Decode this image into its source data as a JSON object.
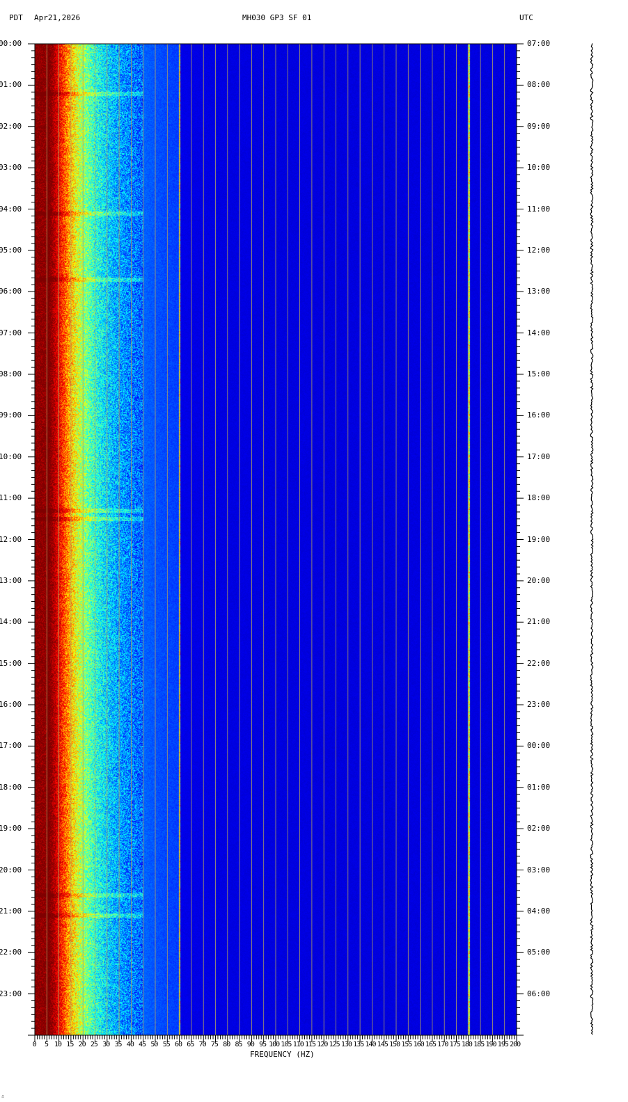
{
  "header": {
    "left_tz": "PDT",
    "date": "Apr21,2026",
    "station": "MH030 GP3 SF 01",
    "right_tz": "UTC"
  },
  "footer_mark": "∴",
  "chart_data": {
    "type": "heatmap",
    "title": "MH030 GP3 SF 01",
    "xlabel": "FREQUENCY (HZ)",
    "xlim": [
      0,
      200
    ],
    "x_ticks": [
      0,
      5,
      10,
      15,
      20,
      25,
      30,
      35,
      40,
      45,
      50,
      55,
      60,
      65,
      70,
      75,
      80,
      85,
      90,
      95,
      100,
      105,
      110,
      115,
      120,
      125,
      130,
      135,
      140,
      145,
      150,
      155,
      160,
      165,
      170,
      175,
      180,
      185,
      190,
      195,
      200
    ],
    "ylim_hours": [
      0,
      24
    ],
    "y_left_labels": [
      "00:00",
      "01:00",
      "02:00",
      "03:00",
      "04:00",
      "05:00",
      "06:00",
      "07:00",
      "08:00",
      "09:00",
      "10:00",
      "11:00",
      "12:00",
      "13:00",
      "14:00",
      "15:00",
      "16:00",
      "17:00",
      "18:00",
      "19:00",
      "20:00",
      "21:00",
      "22:00",
      "23:00"
    ],
    "y_right_labels": [
      "07:00",
      "08:00",
      "09:00",
      "10:00",
      "11:00",
      "12:00",
      "13:00",
      "14:00",
      "15:00",
      "16:00",
      "17:00",
      "18:00",
      "19:00",
      "20:00",
      "21:00",
      "22:00",
      "23:00",
      "00:00",
      "01:00",
      "02:00",
      "03:00",
      "04:00",
      "05:00",
      "06:00"
    ],
    "grid": true,
    "grid_step_hz": 5,
    "narrowband_lines_hz": [
      60,
      180
    ],
    "broadband_events_hours": [
      1.2,
      4.1,
      5.7,
      11.3,
      11.5,
      20.6,
      21.1
    ],
    "colormap": [
      "#00007f",
      "#0000ff",
      "#00ffff",
      "#ffff00",
      "#ff0000",
      "#7f0000"
    ]
  }
}
